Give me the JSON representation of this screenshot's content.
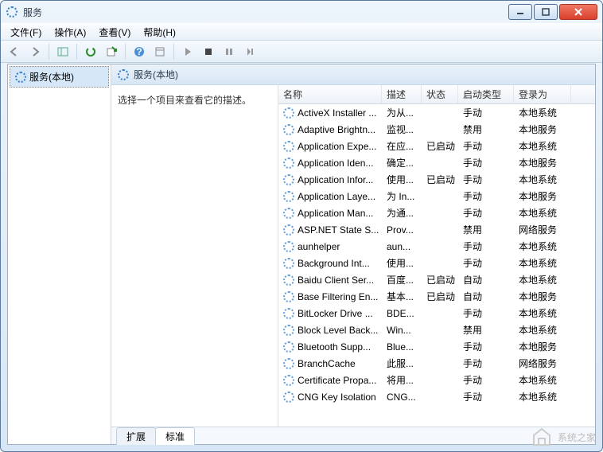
{
  "window": {
    "title": "服务"
  },
  "menu": {
    "file": "文件(F)",
    "action": "操作(A)",
    "view": "查看(V)",
    "help": "帮助(H)"
  },
  "toolbar_icons": {
    "back": "back-icon",
    "forward": "forward-icon",
    "up": "up-icon",
    "show": "show-icon",
    "refresh": "refresh-icon",
    "export": "export-icon",
    "help": "help-icon",
    "props": "props-icon",
    "play": "play-icon",
    "stop": "stop-icon",
    "pause": "pause-icon",
    "restart": "restart-icon"
  },
  "tree": {
    "root": "服务(本地)"
  },
  "header2": "服务(本地)",
  "descpane": {
    "text": "选择一个项目来查看它的描述。"
  },
  "columns": {
    "name": "名称",
    "desc": "描述",
    "status": "状态",
    "startup": "启动类型",
    "logon": "登录为"
  },
  "services": [
    {
      "name": "ActiveX Installer ...",
      "desc": "为从...",
      "status": "",
      "startup": "手动",
      "logon": "本地系统"
    },
    {
      "name": "Adaptive Brightn...",
      "desc": "监视...",
      "status": "",
      "startup": "禁用",
      "logon": "本地服务"
    },
    {
      "name": "Application Expe...",
      "desc": "在应...",
      "status": "已启动",
      "startup": "手动",
      "logon": "本地系统"
    },
    {
      "name": "Application Iden...",
      "desc": "确定...",
      "status": "",
      "startup": "手动",
      "logon": "本地服务"
    },
    {
      "name": "Application Infor...",
      "desc": "使用...",
      "status": "已启动",
      "startup": "手动",
      "logon": "本地系统"
    },
    {
      "name": "Application Laye...",
      "desc": "为 In...",
      "status": "",
      "startup": "手动",
      "logon": "本地服务"
    },
    {
      "name": "Application Man...",
      "desc": "为通...",
      "status": "",
      "startup": "手动",
      "logon": "本地系统"
    },
    {
      "name": "ASP.NET State S...",
      "desc": "Prov...",
      "status": "",
      "startup": "禁用",
      "logon": "网络服务"
    },
    {
      "name": "aunhelper",
      "desc": "aun...",
      "status": "",
      "startup": "手动",
      "logon": "本地系统"
    },
    {
      "name": "Background Int...",
      "desc": "使用...",
      "status": "",
      "startup": "手动",
      "logon": "本地系统"
    },
    {
      "name": "Baidu Client Ser...",
      "desc": "百度...",
      "status": "已启动",
      "startup": "自动",
      "logon": "本地系统"
    },
    {
      "name": "Base Filtering En...",
      "desc": "基本...",
      "status": "已启动",
      "startup": "自动",
      "logon": "本地服务"
    },
    {
      "name": "BitLocker Drive ...",
      "desc": "BDE...",
      "status": "",
      "startup": "手动",
      "logon": "本地系统"
    },
    {
      "name": "Block Level Back...",
      "desc": "Win...",
      "status": "",
      "startup": "禁用",
      "logon": "本地系统"
    },
    {
      "name": "Bluetooth Supp...",
      "desc": "Blue...",
      "status": "",
      "startup": "手动",
      "logon": "本地服务"
    },
    {
      "name": "BranchCache",
      "desc": "此服...",
      "status": "",
      "startup": "手动",
      "logon": "网络服务"
    },
    {
      "name": "Certificate Propa...",
      "desc": "将用...",
      "status": "",
      "startup": "手动",
      "logon": "本地系统"
    },
    {
      "name": "CNG Key Isolation",
      "desc": "CNG...",
      "status": "",
      "startup": "手动",
      "logon": "本地系统"
    }
  ],
  "tabs": {
    "extended": "扩展",
    "standard": "标准"
  },
  "watermark": "系统之家"
}
